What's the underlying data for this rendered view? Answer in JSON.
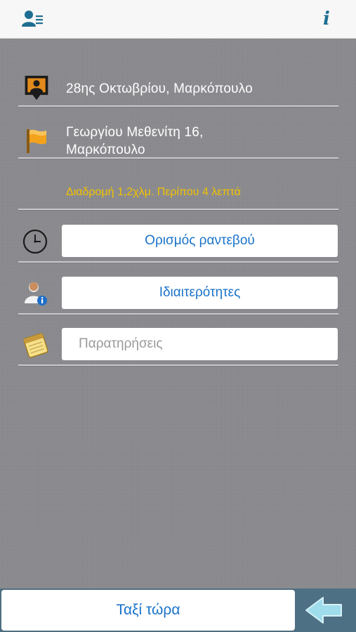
{
  "header": {
    "left_icon": "user-list-icon",
    "right_icon": "info-icon",
    "info_glyph": "i"
  },
  "pickup": {
    "icon": "person-pin-icon",
    "address": "28ης Οκτωβρίου, Μαρκόπουλο"
  },
  "destination": {
    "icon": "flag-icon",
    "address_line1": "Γεωργίου Μεθενίτη 16,",
    "address_line2": "Μαρκόπουλο"
  },
  "route": {
    "info": "Διαδρομή 1,2χλμ. Περίπου 4 λεπτά"
  },
  "appointment": {
    "icon": "clock-icon",
    "label": "Ορισμός ραντεβού"
  },
  "features": {
    "icon": "user-info-icon",
    "label": "Ιδιαιτερότητες"
  },
  "notes": {
    "icon": "notepad-icon",
    "placeholder": "Παρατηρήσεις",
    "value": ""
  },
  "footer": {
    "taxi_now_label": "Ταξί τώρα",
    "back_icon": "back-arrow-icon"
  },
  "colors": {
    "accent_blue": "#1a73c9",
    "route_yellow": "#f2c200",
    "background_gray": "#8c8c90",
    "footer_blue": "#4f6e80"
  }
}
